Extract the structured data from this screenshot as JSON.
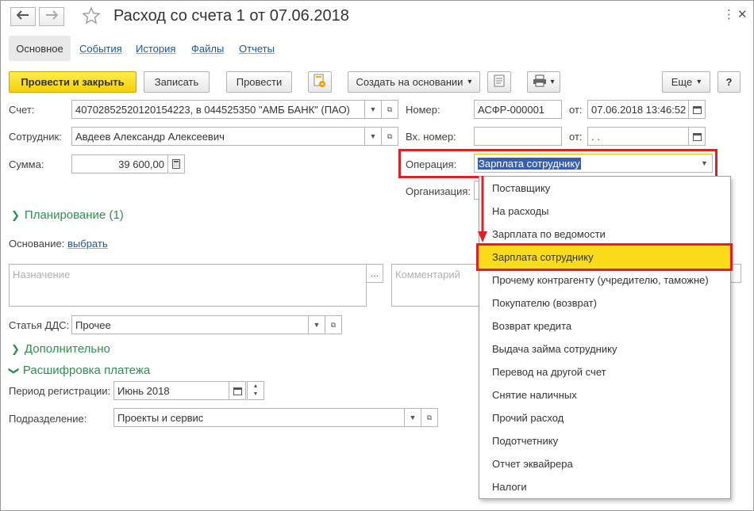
{
  "window": {
    "title": "Расход со счета 1 от 07.06.2018",
    "back_glyph": "🡐",
    "forward_glyph": "🡒",
    "star_glyph": "☆",
    "menu_glyph": "⋮",
    "close_glyph": "✕"
  },
  "tabs": [
    {
      "label": "Основное",
      "active": true
    },
    {
      "label": "События"
    },
    {
      "label": "История"
    },
    {
      "label": "Файлы"
    },
    {
      "label": "Отчеты"
    }
  ],
  "toolbar": {
    "post_close": "Провести и закрыть",
    "save": "Записать",
    "post": "Провести",
    "create_based": "Создать на основании",
    "more": "Еще",
    "help": "?",
    "dropdown_glyph": "▾",
    "accent_color": "#f5d009"
  },
  "form": {
    "account_label": "Счет:",
    "account_value": "40702852520120154223, в 044525350 \"АМБ БАНК\" (ПАО)",
    "employee_label": "Сотрудник:",
    "employee_value": "Авдеев Александр Алексеевич",
    "sum_label": "Сумма:",
    "sum_value": "39 600,00",
    "number_label": "Номер:",
    "number_value": "АСФР-000001",
    "date_label": "от:",
    "date_value": "07.06.2018 13:46:52",
    "in_number_label": "Вх. номер:",
    "in_number_value": "",
    "in_date_label": "от:",
    "in_date_value": " .  .",
    "operation_label": "Операция:",
    "operation_value": "Зарплата сотруднику",
    "organization_label": "Организация:",
    "planning_section": "Планирование (1)",
    "basis_label": "Основание:",
    "basis_link": "выбрать",
    "purpose_placeholder": "Назначение",
    "comment_placeholder": "Комментарий",
    "dds_label": "Статья ДДС:",
    "dds_value": "Прочее",
    "additional_section": "Дополнительно",
    "payment_section": "Расшифровка платежа",
    "period_label": "Период регистрации:",
    "period_value": "Июнь 2018",
    "division_label": "Подразделение:",
    "division_value": "Проекты и сервис",
    "ellipsis": "..."
  },
  "operation_dropdown": {
    "items": [
      "Поставщику",
      "На расходы",
      "Зарплата по ведомости",
      "Зарплата сотруднику",
      "Прочему контрагенту (учредителю, таможне)",
      "Покупателю (возврат)",
      "Возврат кредита",
      "Выдача займа сотруднику",
      "Перевод на другой счет",
      "Снятие наличных",
      "Прочий расход",
      "Подотчетнику",
      "Отчет эквайрера",
      "Налоги"
    ],
    "selected_index": 3,
    "highlight_color": "#fbdc1a",
    "annotation_color": "#e01f26"
  }
}
